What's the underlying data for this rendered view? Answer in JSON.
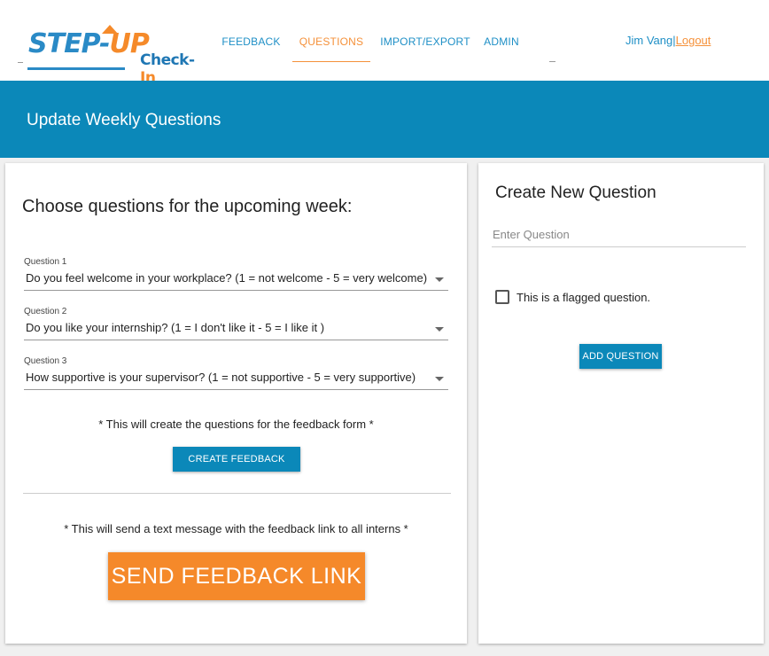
{
  "brand": {
    "logo_text": "STEP-UP",
    "product_name_1": "Check-",
    "product_name_2": "In"
  },
  "nav": {
    "items": [
      {
        "label": "FEEDBACK",
        "active": false
      },
      {
        "label": "QUESTIONS",
        "active": true
      },
      {
        "label": "IMPORT/EXPORT",
        "active": false
      },
      {
        "label": "ADMIN",
        "active": false
      }
    ]
  },
  "user": {
    "name": "Jim Vang",
    "separator": "|",
    "logout_label": "Logout"
  },
  "banner": {
    "title": "Update Weekly Questions"
  },
  "choose": {
    "title": "Choose questions for the upcoming week:",
    "questions": [
      {
        "label": "Question 1",
        "value": "Do you feel welcome in your workplace? (1 = not welcome - 5 = very welcome)"
      },
      {
        "label": "Question 2",
        "value": "Do you like your internship? (1 = I don't like it - 5 = I like it )"
      },
      {
        "label": "Question 3",
        "value": "How supportive is your supervisor? (1 = not supportive - 5 = very supportive)"
      }
    ],
    "create_note": "* This will create the questions for the feedback form *",
    "create_button": "CREATE FEEDBACK FORM",
    "send_note": "* This will send a text message with the feedback link to all interns *",
    "send_button": "SEND FEEDBACK LINK"
  },
  "create": {
    "title": "Create New Question",
    "input_placeholder": "Enter Question",
    "input_value": "",
    "flag_label": "This is a flagged question.",
    "flag_checked": false,
    "add_button": "ADD QUESTION"
  },
  "colors": {
    "primary": "#0b88b9",
    "accent": "#f5892a",
    "link": "#1e8fc6"
  }
}
